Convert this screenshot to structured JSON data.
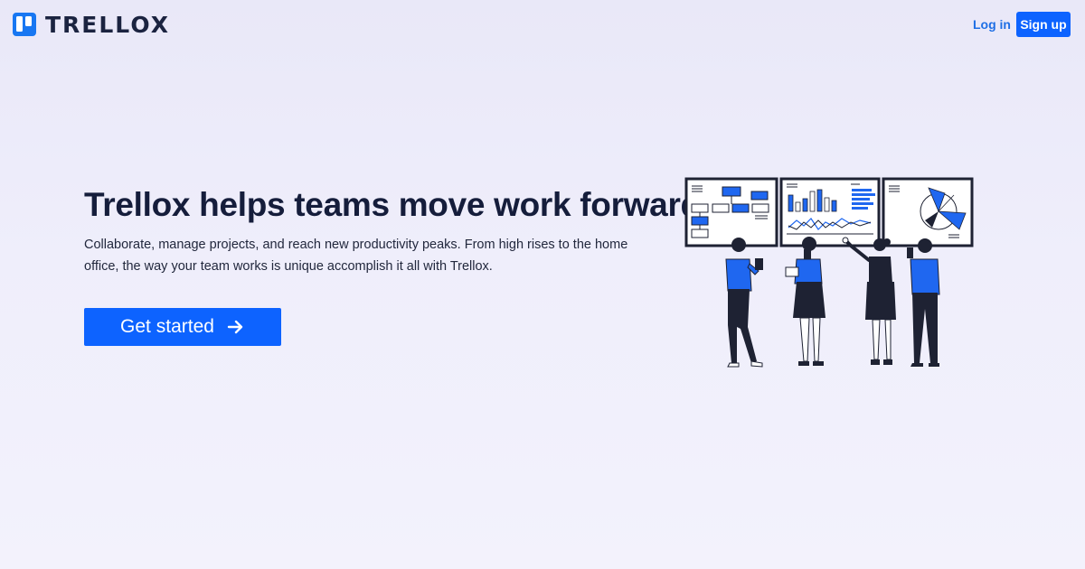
{
  "header": {
    "brand_name": "TRELLOX",
    "login_label": "Log in",
    "signup_label": "Sign up"
  },
  "hero": {
    "title": "Trellox helps teams move work forward.",
    "description": "Collaborate, manage projects, and reach new productivity peaks. From high rises to the home office, the way your team works is unique accomplish it all with Trellox.",
    "cta_label": "Get started"
  },
  "colors": {
    "brand": "#0d63ff",
    "title": "#151d3b",
    "background": "#ecebf9"
  },
  "icons": {
    "logo": "trellox-board-icon",
    "cta": "arrow-right-icon"
  }
}
